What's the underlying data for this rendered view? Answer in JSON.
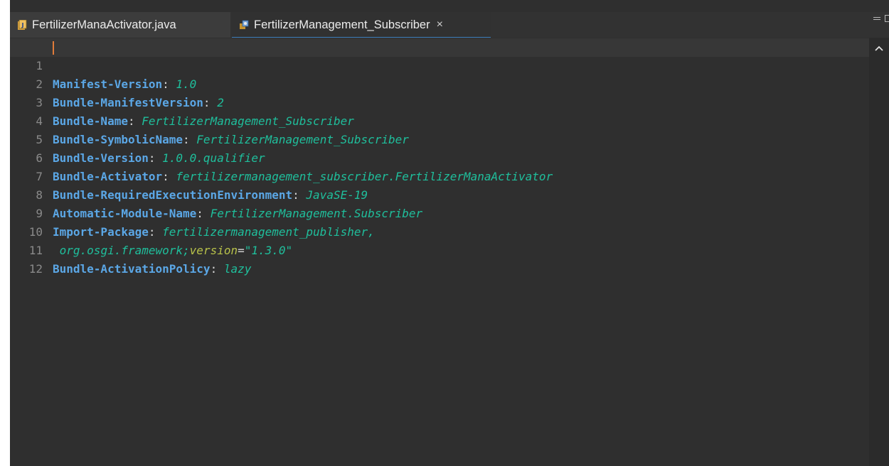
{
  "tabs": [
    {
      "label": "FertilizerManaActivator.java",
      "icon": "java-file-icon"
    },
    {
      "label": "FertilizerManagement_Subscriber",
      "icon": "plugin-manifest-icon",
      "close": "×"
    }
  ],
  "lines": [
    {
      "n": "1",
      "key": "Manifest-Version",
      "sep": ": ",
      "val": "1.0"
    },
    {
      "n": "2",
      "key": "Bundle-ManifestVersion",
      "sep": ": ",
      "val": "2"
    },
    {
      "n": "3",
      "key": "Bundle-Name",
      "sep": ": ",
      "val": "FertilizerManagement_Subscriber"
    },
    {
      "n": "4",
      "key": "Bundle-SymbolicName",
      "sep": ": ",
      "val": "FertilizerManagement_Subscriber"
    },
    {
      "n": "5",
      "key": "Bundle-Version",
      "sep": ": ",
      "val": "1.0.0.qualifier"
    },
    {
      "n": "6",
      "key": "Bundle-Activator",
      "sep": ": ",
      "val": "fertilizermanagement_subscriber.FertilizerManaActivator"
    },
    {
      "n": "7",
      "key": "Bundle-RequiredExecutionEnvironment",
      "sep": ": ",
      "val": "JavaSE-19"
    },
    {
      "n": "8",
      "key": "Automatic-Module-Name",
      "sep": ": ",
      "val": "FertilizerManagement.Subscriber"
    },
    {
      "n": "9",
      "key": "Import-Package",
      "sep": ": ",
      "val": "fertilizermanagement_publisher,"
    },
    {
      "n": "10",
      "indent": " ",
      "val1": "org.osgi.framework;",
      "attr": "version",
      "eq": "=",
      "val2": "\"1.3.0\""
    },
    {
      "n": "11",
      "key": "Bundle-ActivationPolicy",
      "sep": ": ",
      "val": "lazy"
    },
    {
      "n": "12"
    }
  ]
}
